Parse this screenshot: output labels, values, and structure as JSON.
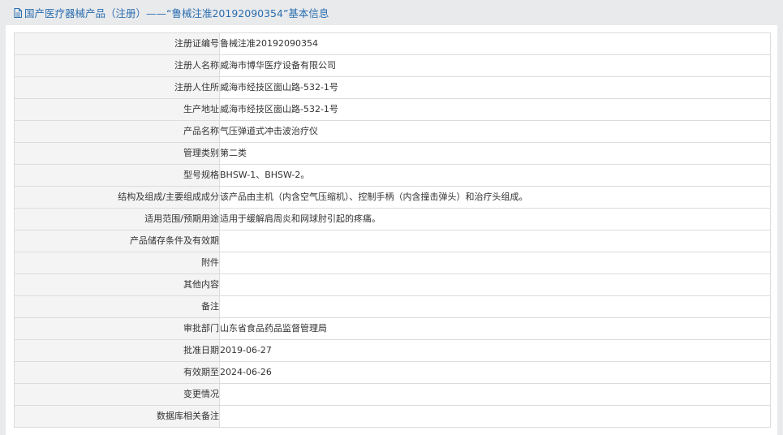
{
  "header": {
    "title": "国产医疗器械产品（注册）——“鲁械注准20192090354”基本信息",
    "icon": "document-icon",
    "color": "#2a6eb0"
  },
  "rows": [
    {
      "label": "注册证编号",
      "value": "鲁械注准20192090354"
    },
    {
      "label": "注册人名称",
      "value": "威海市博华医疗设备有限公司"
    },
    {
      "label": "注册人住所",
      "value": "威海市经技区崮山路-532-1号"
    },
    {
      "label": "生产地址",
      "value": "威海市经技区崮山路-532-1号"
    },
    {
      "label": "产品名称",
      "value": "气压弹道式冲击波治疗仪"
    },
    {
      "label": "管理类别",
      "value": "第二类"
    },
    {
      "label": "型号规格",
      "value": "BHSW-1、BHSW-2。"
    },
    {
      "label": "结构及组成/主要组成成分",
      "value": "该产品由主机（内含空气压缩机）、控制手柄（内含撞击弹头）和治疗头组成。"
    },
    {
      "label": "适用范围/预期用途",
      "value": "适用于缓解肩周炎和网球肘引起的疼痛。"
    },
    {
      "label": "产品储存条件及有效期",
      "value": ""
    },
    {
      "label": "附件",
      "value": ""
    },
    {
      "label": "其他内容",
      "value": ""
    },
    {
      "label": "备注",
      "value": ""
    },
    {
      "label": "审批部门",
      "value": "山东省食品药品监督管理局"
    },
    {
      "label": "批准日期",
      "value": "2019-06-27"
    },
    {
      "label": "有效期至",
      "value": "2024-06-26"
    },
    {
      "label": "变更情况",
      "value": ""
    },
    {
      "label": "数据库相关备注",
      "value": ""
    }
  ]
}
